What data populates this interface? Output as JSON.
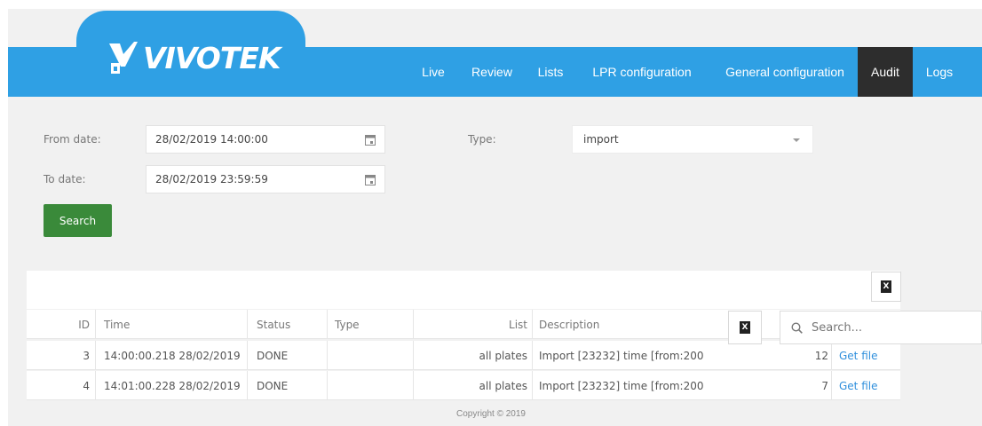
{
  "brand": {
    "logo_text": "VIVOTEK",
    "logo_icon": "vivotek-v-icon"
  },
  "nav": {
    "items": [
      {
        "label": "Live"
      },
      {
        "label": "Review"
      },
      {
        "label": "Lists"
      },
      {
        "label": "LPR configuration"
      },
      {
        "label": "General configuration"
      },
      {
        "label": "Audit"
      },
      {
        "label": "Logs"
      }
    ],
    "active": "Audit"
  },
  "form": {
    "from_label": "From date:",
    "from_value": "28/02/2019 14:00:00",
    "to_label": "To date:",
    "to_value": "28/02/2019 23:59:59",
    "type_label": "Type:",
    "type_value": "import",
    "search_label": "Search"
  },
  "table": {
    "columns": [
      "ID",
      "Time",
      "Status",
      "Type",
      "List",
      "Description"
    ],
    "rows": [
      {
        "id": "3",
        "time": "14:00:00.218 28/02/2019",
        "status": "DONE",
        "type": "",
        "list": "all plates",
        "description": "Import [23232] time [from:200",
        "count": "12",
        "action": "Get file"
      },
      {
        "id": "4",
        "time": "14:01:00.228 28/02/2019",
        "status": "DONE",
        "type": "",
        "list": "all plates",
        "description": "Import [23232] time [from:200",
        "count": "7",
        "action": "Get file"
      }
    ],
    "search_placeholder": "Search...",
    "export_icon": "excel-export-icon"
  },
  "footer": {
    "copyright": "Copyright © 2019"
  },
  "colors": {
    "header": "#2fa0e4",
    "active_nav": "#2d2d2d",
    "search_button": "#3a8a3a",
    "link": "#2f8fdc"
  }
}
